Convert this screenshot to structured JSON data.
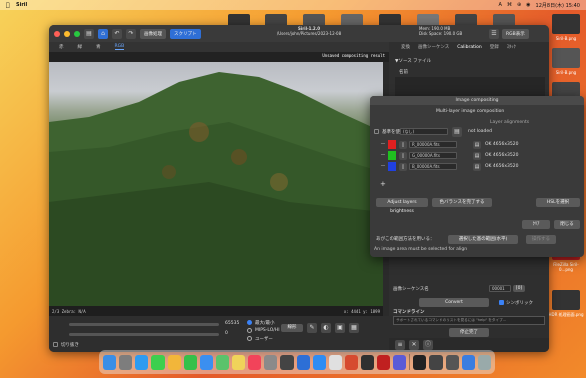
{
  "menubar": {
    "apple": "",
    "app": "Siril",
    "status_icons": [
      "A",
      "⌘",
      "⊕",
      "◉"
    ],
    "clock": "12月8日(木) 15:40"
  },
  "desktop": {
    "icons": [
      {
        "label": "Siril-B.png"
      },
      {
        "label": "Siril-B.png"
      },
      {
        "label": "Siril-B.png"
      },
      {
        "label": "Siril-1.2-FUJ...png"
      },
      {
        "label": "Siril-1-4-03..."
      },
      {
        "label": "FileZilla ...png"
      },
      {
        "label": "FileZilla Siril-0...png"
      },
      {
        "label": "HDR 処理画面.png"
      }
    ]
  },
  "window": {
    "title": "Siril-1.2.0",
    "subtitle": "/Users/john/Pictures/2023-12-08",
    "info_right": [
      "Mem: 190.0 MB",
      "Disk Space: 190.0 GB"
    ],
    "toolbar": {
      "image_processing": "画像処理",
      "scripts": "スクリプト",
      "rgb_display": "RGB表示"
    },
    "view_tabs": [
      "赤",
      "緑",
      "青",
      "RGB"
    ],
    "image_label": "Unsaved compositing result",
    "status_left": "2/3  Zebra: N/A",
    "status_right": "x: 4441  y: 1899",
    "bottom": {
      "slider_value": "65535",
      "slider_value2": "0",
      "cut_label": "切り抜き",
      "radio1": "最大/最小",
      "radio2": "MIPS-LO/HI",
      "radio3": "ユーザー",
      "mode": "線形"
    }
  },
  "right_panel": {
    "tabs": [
      "変換",
      "画像シーケンス",
      "Calibration",
      "登録",
      "ｽﾀｯｸ"
    ],
    "source_section": "▼ソース ファイル",
    "field1": "名前",
    "sequence_label": "画像シーケンス名",
    "sequence_value": "00001",
    "sequence_btn": "[0]",
    "convert_btn": "Convert",
    "symbolic_label": "シンボリック",
    "command_label": "コマンドライン",
    "command_placeholder": "サポートされているコマンドのリストを見るには \"help\" をタイプ...",
    "command_done": "停止完了"
  },
  "dialog": {
    "title": "Image compositing",
    "heading": "Multi-layer image composition",
    "layer_alignment": "Layer alignments",
    "reference_label": "基準を使用",
    "none_label": "(なし)",
    "not_loaded": "not loaded",
    "layers": [
      {
        "color": "#e02020",
        "file": "R_00000A.fits",
        "size": "OK 4656x3520"
      },
      {
        "color": "#20c020",
        "file": "G_00000A.fits",
        "size": "OK 4656x3520"
      },
      {
        "color": "#2040e0",
        "file": "B_00000A.fits",
        "size": "OK 4656x3520"
      }
    ],
    "add_btn": "+",
    "adjust_btn": "Adjust layers brightness",
    "color_balance_btn": "色バランスを完了する",
    "hsl_label": "HSLを選択",
    "cancel_btn": "ｸﾘｱ",
    "close_btn": "閉じる",
    "align_label": "あがこの範囲方法を用いる：",
    "select_label": "選択した基の範囲(水平)",
    "run_btn": "操作する",
    "warning": "An image area must be selected for align"
  },
  "dock": {
    "apps": [
      {
        "name": "finder",
        "color": "#3a8ee6"
      },
      {
        "name": "launchpad",
        "color": "#7d7d7d"
      },
      {
        "name": "safari",
        "color": "#2e9bf0"
      },
      {
        "name": "messages",
        "color": "#3ccf4e"
      },
      {
        "name": "photos",
        "color": "#f2b63a"
      },
      {
        "name": "facetime",
        "color": "#35c04a"
      },
      {
        "name": "mail",
        "color": "#3b8ff0"
      },
      {
        "name": "maps",
        "color": "#5ac36b"
      },
      {
        "name": "notes",
        "color": "#f0d35a"
      },
      {
        "name": "music",
        "color": "#f2435a"
      },
      {
        "name": "settings",
        "color": "#8a8a8a"
      },
      {
        "name": "camera",
        "color": "#444"
      },
      {
        "name": "globe",
        "color": "#2d6fd6"
      },
      {
        "name": "app-store",
        "color": "#2f8cf2"
      },
      {
        "name": "bbedit",
        "color": "#e0e0e0"
      },
      {
        "name": "siril",
        "color": "#d64a2f"
      },
      {
        "name": "telescope",
        "color": "#303030"
      },
      {
        "name": "filezilla",
        "color": "#c02020"
      },
      {
        "name": "paint",
        "color": "#5b5bd6"
      },
      {
        "name": "terminal",
        "color": "#222"
      },
      {
        "name": "siril-window",
        "color": "#444"
      },
      {
        "name": "finder-window",
        "color": "#555"
      },
      {
        "name": "downloads",
        "color": "#3a7de0"
      },
      {
        "name": "trash",
        "color": "#9aa"
      }
    ]
  }
}
